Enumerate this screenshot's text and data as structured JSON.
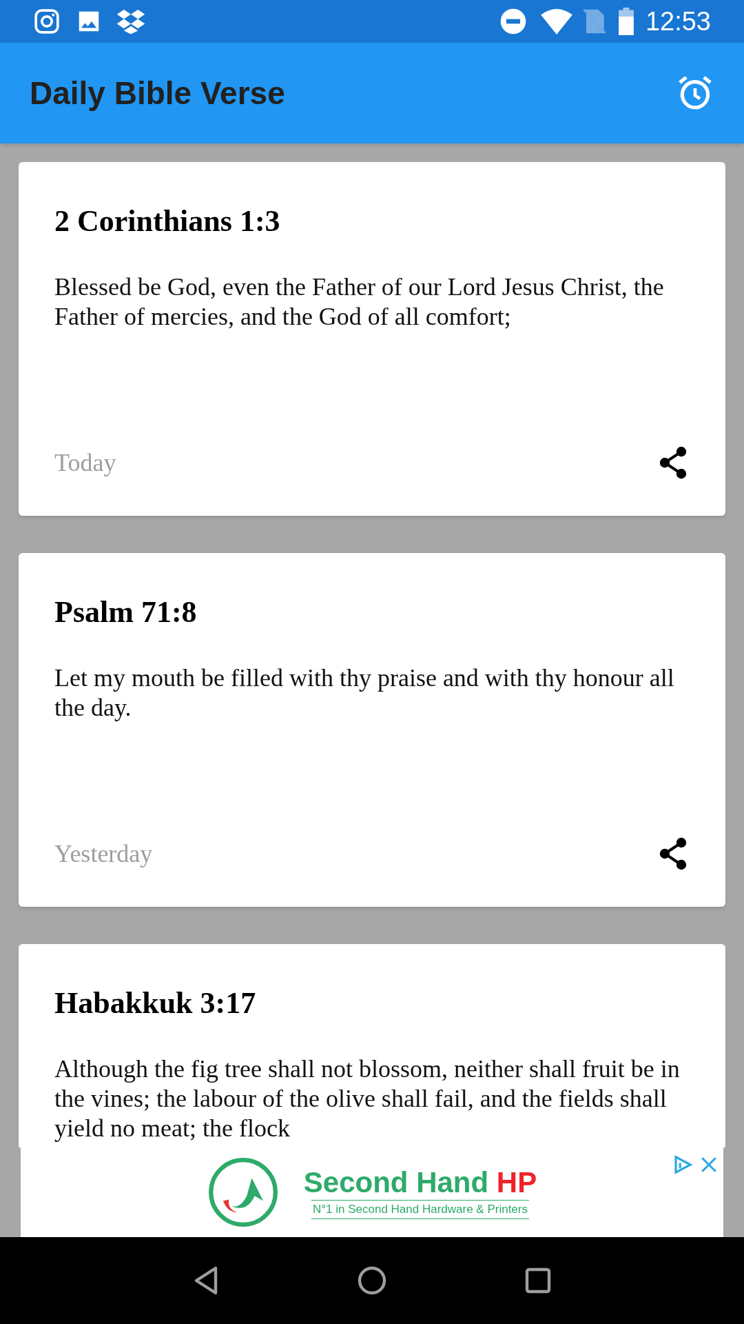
{
  "status_bar": {
    "time": "12:53"
  },
  "app_bar": {
    "title": "Daily Bible Verse"
  },
  "verses": [
    {
      "reference": "2 Corinthians 1:3",
      "text": "Blessed be God, even the Father of our Lord Jesus Christ, the Father of mercies, and the God of all comfort;",
      "date": "Today"
    },
    {
      "reference": "Psalm 71:8",
      "text": "Let my mouth be filled with thy praise and with thy honour all the day.",
      "date": "Yesterday"
    },
    {
      "reference": "Habakkuk 3:17",
      "text": "Although the fig tree shall not blossom, neither shall fruit be in the vines; the labour of the olive shall fail, and the fields shall yield no meat; the flock"
    }
  ],
  "ad": {
    "brand": "Second Hand",
    "brand_highlight": "HP",
    "tagline": "N°1 in Second Hand Hardware & Printers"
  }
}
